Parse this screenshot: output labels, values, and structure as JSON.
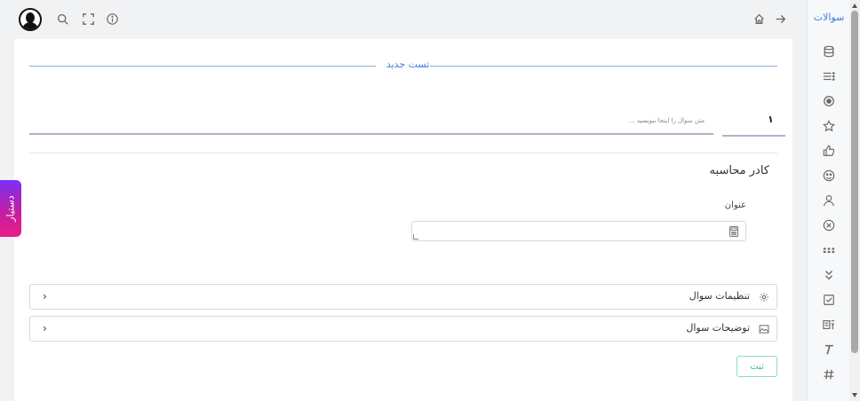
{
  "sidebar": {
    "title": "سوالات",
    "icons": [
      "database-icon",
      "list-icon",
      "radio-icon",
      "star-icon",
      "thumbs-up-icon",
      "smiley-icon",
      "user-icon",
      "close-circle-icon",
      "grid-icon",
      "chevrons-down-icon",
      "checkbox-icon",
      "form-icon",
      "text-icon",
      "hash-icon"
    ]
  },
  "topbar": {
    "left_icons": [
      "avatar",
      "search-icon",
      "fullscreen-icon",
      "info-icon"
    ],
    "right_icons": [
      "home-icon",
      "arrow-right-icon"
    ]
  },
  "form": {
    "legend": "تست جدید",
    "question_number": "۱",
    "question_placeholder": "متن سوال را اینجا بنویسید ..."
  },
  "calculator": {
    "title": "کادر محاسبه",
    "field_label": "عنوان"
  },
  "accordions": [
    {
      "label": "تنظیمات سوال",
      "icon": "settings-icon",
      "chevron": "›"
    },
    {
      "label": "توضیحات سوال",
      "icon": "image-icon",
      "chevron": "›"
    }
  ],
  "submit_label": "ثبت",
  "helper_tab": "دستیار",
  "colors": {
    "accent": "#3b7ddd",
    "submit": "#3ec48a",
    "helper_start": "#7b2ff7",
    "helper_end": "#e91e8c"
  }
}
